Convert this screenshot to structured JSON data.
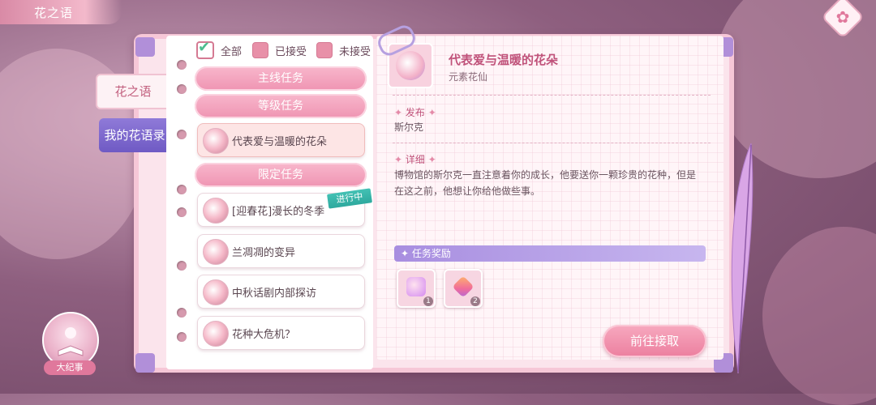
{
  "header": {
    "title": "花之语"
  },
  "side_tabs": [
    {
      "label": "花之语"
    },
    {
      "label": "我的花语录"
    }
  ],
  "filters": [
    {
      "label": "全部",
      "checked": true
    },
    {
      "label": "已接受",
      "checked": false
    },
    {
      "label": "未接受",
      "checked": false
    }
  ],
  "categories": {
    "main": "主线任务",
    "level": "等级任务",
    "limited": "限定任务"
  },
  "tasks": [
    {
      "label": "代表爱与温暖的花朵",
      "selected": true
    },
    {
      "label": "[迎春花]漫长的冬季",
      "status": "进行中"
    },
    {
      "label": "兰凋凋的变异"
    },
    {
      "label": "中秋话剧内部探访"
    },
    {
      "label": "花种大危机？"
    }
  ],
  "detail": {
    "title": "代表爱与温暖的花朵",
    "subtitle": "元素花仙",
    "publish_label": "发布",
    "publisher": "斯尔克",
    "detail_label": "详细",
    "description": "博物馆的斯尔克一直注意着你的成长，他要送你一颗珍贵的花种，但是在这之前，他想让你给他做些事。",
    "reward_label": "任务奖励",
    "rewards": [
      {
        "count": "1"
      },
      {
        "count": "2"
      }
    ],
    "action_button": "前往接取"
  },
  "bottom": {
    "big_event_label": "大纪事"
  }
}
